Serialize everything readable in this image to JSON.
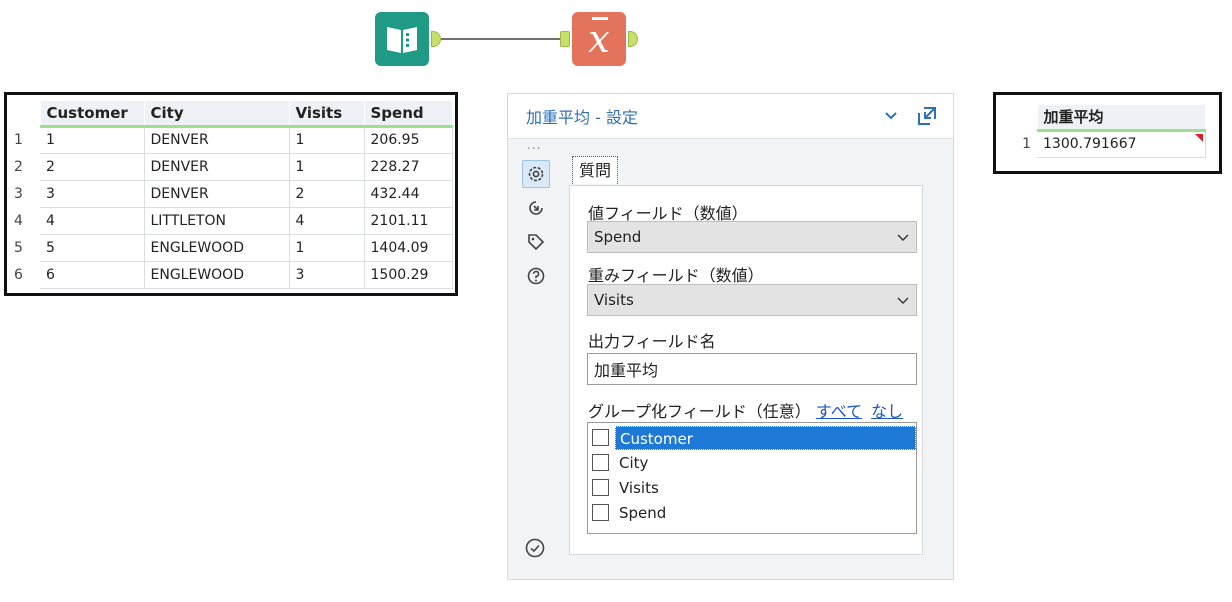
{
  "input_table": {
    "columns": [
      "Customer",
      "City",
      "Visits",
      "Spend"
    ],
    "rows": [
      {
        "n": "1",
        "cells": [
          "1",
          "DENVER",
          "1",
          "206.95"
        ]
      },
      {
        "n": "2",
        "cells": [
          "2",
          "DENVER",
          "1",
          "228.27"
        ]
      },
      {
        "n": "3",
        "cells": [
          "3",
          "DENVER",
          "2",
          "432.44"
        ]
      },
      {
        "n": "4",
        "cells": [
          "4",
          "LITTLETON",
          "4",
          "2101.11"
        ]
      },
      {
        "n": "5",
        "cells": [
          "5",
          "ENGLEWOOD",
          "1",
          "1404.09"
        ]
      },
      {
        "n": "6",
        "cells": [
          "6",
          "ENGLEWOOD",
          "3",
          "1500.29"
        ]
      }
    ]
  },
  "output_table": {
    "columns": [
      "加重平均"
    ],
    "rows": [
      {
        "n": "1",
        "cells": [
          "1300.791667"
        ]
      }
    ]
  },
  "panel": {
    "title": "加重平均 - 設定",
    "dots": "...",
    "tab_label": "質問",
    "value_field_label": "値フィールド（数値）",
    "value_field_selected": "Spend",
    "weight_field_label": "重みフィールド（数値）",
    "weight_field_selected": "Visits",
    "output_name_label": "出力フィールド名",
    "output_name_value": "加重平均",
    "group_label": "グループ化フィールド（任意）",
    "select_all": "すべて",
    "select_none": "なし",
    "group_fields": [
      {
        "label": "Customer",
        "checked": false,
        "selected": true
      },
      {
        "label": "City",
        "checked": false,
        "selected": false
      },
      {
        "label": "Visits",
        "checked": false,
        "selected": false
      },
      {
        "label": "Spend",
        "checked": false,
        "selected": false
      }
    ]
  },
  "icons": {
    "input_tool": "book-icon",
    "formula_tool": "x-bar-icon",
    "collapse": "chevron-down-icon",
    "undock": "undock-icon",
    "configuration": "gear-icon",
    "annotation": "arrow-circle-icon",
    "metadata": "tag-icon",
    "help": "question-icon",
    "status": "check-circle-icon"
  },
  "colors": {
    "input_tool": "#1f9a84",
    "formula_tool": "#e3735a",
    "accent": "#2f6fb5",
    "selection": "#1e78d6"
  }
}
